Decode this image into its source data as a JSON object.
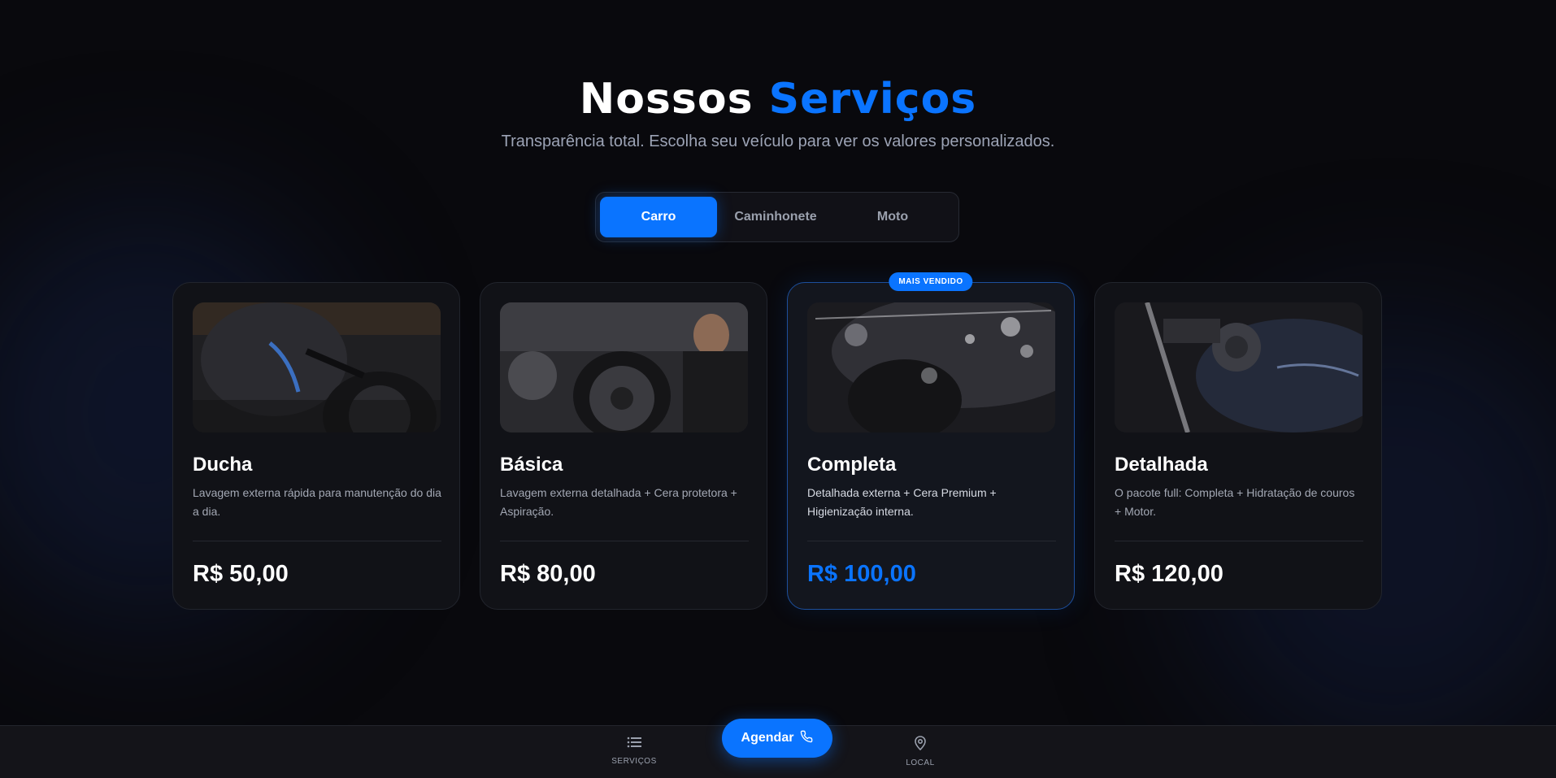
{
  "header": {
    "title_part1": "Nossos",
    "title_part2": "Serviços",
    "subtitle": "Transparência total. Escolha seu veículo para ver os valores personalizados."
  },
  "vehicle_tabs": [
    {
      "label": "Carro",
      "active": true
    },
    {
      "label": "Caminhonete",
      "active": false
    },
    {
      "label": "Moto",
      "active": false
    }
  ],
  "services": [
    {
      "title": "Ducha",
      "description": "Lavagem externa rápida para manutenção do dia a dia.",
      "price": "R$ 50,00"
    },
    {
      "title": "Básica",
      "description": "Lavagem externa detalhada + Cera protetora + Aspiração.",
      "price": "R$ 80,00"
    },
    {
      "title": "Completa",
      "description": "Detalhada externa + Cera Premium + Higienização interna.",
      "price": "R$ 100,00",
      "badge": "MAIS VENDIDO"
    },
    {
      "title": "Detalhada",
      "description": "O pacote full: Completa + Hidratação de couros + Motor.",
      "price": "R$ 120,00"
    }
  ],
  "bottom_nav": {
    "services_label": "SERVIÇOS",
    "services_icon": "list-icon",
    "cta_label": "Agendar",
    "cta_icon": "phone-icon",
    "location_label": "LOCAL",
    "location_icon": "map-pin-icon"
  },
  "colors": {
    "accent": "#0a74ff",
    "background": "#09090d",
    "card": "#111217"
  }
}
